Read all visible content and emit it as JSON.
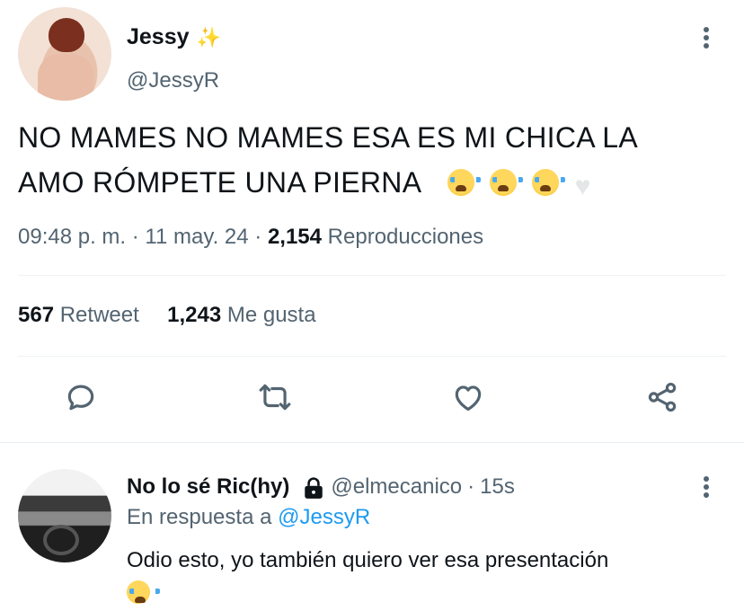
{
  "tweet": {
    "author_name": "Jessy",
    "author_emoji": "✨",
    "author_handle": "@JessyR",
    "text_line1": "NO MAMES NO MAMES ESA ES MI CHICA LA",
    "text_line2": "AMO RÓMPETE UNA PIERNA",
    "text_emojis": [
      "loudly-crying-face",
      "loudly-crying-face",
      "loudly-crying-face",
      "white-heart"
    ],
    "time": "09:48 p. m.",
    "separator": "·",
    "date": "11 may. 24",
    "views_count": "2,154",
    "views_label": "Reproducciones",
    "retweets_count": "567",
    "retweets_label": "Retweet",
    "likes_count": "1,243",
    "likes_label": "Me gusta"
  },
  "actions": [
    "reply-icon",
    "retweet-icon",
    "like-icon",
    "share-icon"
  ],
  "reply": {
    "author_name": "No lo sé Ric(hy)",
    "author_handle": "@elmecanico",
    "separator": "·",
    "time_ago": "15s",
    "replying_prefix": "En respuesta a",
    "replying_to": "@JessyR",
    "text": "Odio esto, yo también quiero ver esa presentación",
    "text_emoji": "loudly-crying-face"
  },
  "colors": {
    "text_primary": "#0f1419",
    "text_secondary": "#536471",
    "link": "#1d9bf0",
    "divider": "#eff3f4"
  }
}
